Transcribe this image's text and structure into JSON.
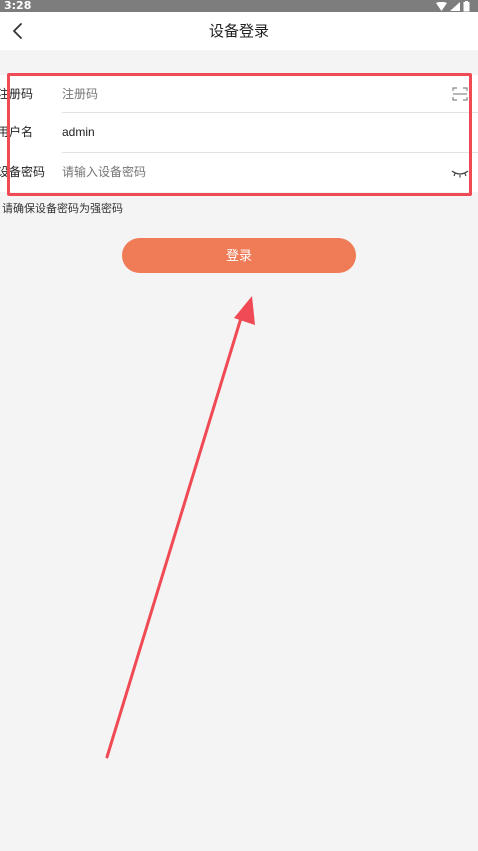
{
  "status": {
    "time": "3:28"
  },
  "header": {
    "title": "设备登录"
  },
  "form": {
    "registration": {
      "label": "注册码",
      "placeholder": "注册码"
    },
    "username": {
      "label": "用户名",
      "value": "admin"
    },
    "password": {
      "label": "设备密码",
      "placeholder": "请输入设备密码"
    }
  },
  "hint": "请确保设备密码为强密码",
  "login_button": "登录",
  "colors": {
    "accent": "#ef7b57",
    "annotation": "#f04a55"
  }
}
